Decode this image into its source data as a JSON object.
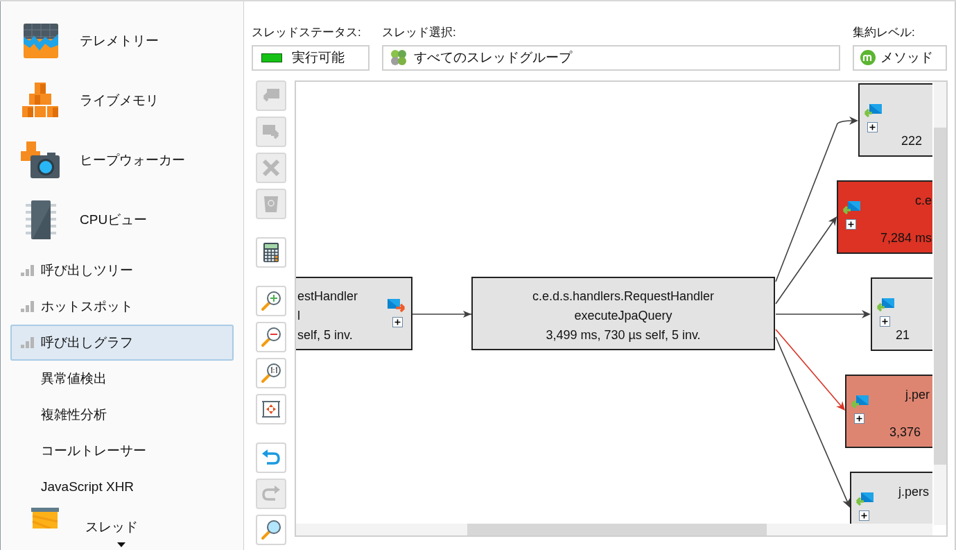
{
  "sidebar": {
    "items": [
      {
        "kind": "section",
        "label": "テレメトリー",
        "selected": false
      },
      {
        "kind": "section",
        "label": "ライブメモリ",
        "selected": false
      },
      {
        "kind": "section",
        "label": "ヒープウォーカー",
        "selected": false
      },
      {
        "kind": "section",
        "label": "CPUビュー",
        "selected": false
      },
      {
        "kind": "cpu-view",
        "label": "呼び出しツリー",
        "selected": false
      },
      {
        "kind": "cpu-view",
        "label": "ホットスポット",
        "selected": false
      },
      {
        "kind": "cpu-view",
        "label": "呼び出しグラフ",
        "selected": true
      },
      {
        "kind": "view",
        "label": "異常値検出",
        "selected": false
      },
      {
        "kind": "view",
        "label": "複雑性分析",
        "selected": false
      },
      {
        "kind": "view",
        "label": "コールトレーサー",
        "selected": false
      },
      {
        "kind": "view",
        "label": "JavaScript XHR",
        "selected": false
      },
      {
        "kind": "section",
        "label": "スレッド",
        "selected": false
      }
    ]
  },
  "filters": {
    "thread_status": {
      "label": "スレッドステータス:",
      "value": "実行可能"
    },
    "thread_selection": {
      "label": "スレッド選択:",
      "value": "すべてのスレッドグループ"
    },
    "aggregation_level": {
      "label": "集約レベル:",
      "value": "メソッド"
    }
  },
  "toolbar": [
    {
      "kind": "back",
      "disabled": true
    },
    {
      "kind": "forward",
      "disabled": true
    },
    {
      "kind": "remove",
      "disabled": true
    },
    {
      "kind": "trash",
      "disabled": true
    },
    {
      "kind": "calculator",
      "disabled": false
    },
    {
      "kind": "zoom-in",
      "disabled": false
    },
    {
      "kind": "zoom-out",
      "disabled": false
    },
    {
      "kind": "zoom-reset",
      "disabled": false
    },
    {
      "kind": "fit",
      "disabled": false
    },
    {
      "kind": "undo",
      "disabled": false
    },
    {
      "kind": "redo",
      "disabled": true
    },
    {
      "kind": "find",
      "disabled": false
    }
  ],
  "graph": {
    "caller": {
      "lines": [
        "estHandler",
        "l",
        "self, 5 inv."
      ]
    },
    "focus": {
      "lines": [
        "c.e.d.s.handlers.RequestHandler",
        "executeJpaQuery",
        "3,499 ms, 730 µs self, 5 inv."
      ]
    },
    "callees": [
      {
        "timing": "222",
        "color": "#e3e3e3",
        "hot_path": false
      },
      {
        "name": "c.e",
        "timing": "7,284 ms",
        "color": "#dc3324",
        "hot_path": false
      },
      {
        "timing": "21",
        "color": "#e3e3e3",
        "hot_path": false
      },
      {
        "name": "j.per",
        "timing": "3,376",
        "color": "#de8572",
        "hot_path": true
      },
      {
        "name": "j.pers",
        "color": "#e3e3e3",
        "hot_path": false
      }
    ]
  }
}
